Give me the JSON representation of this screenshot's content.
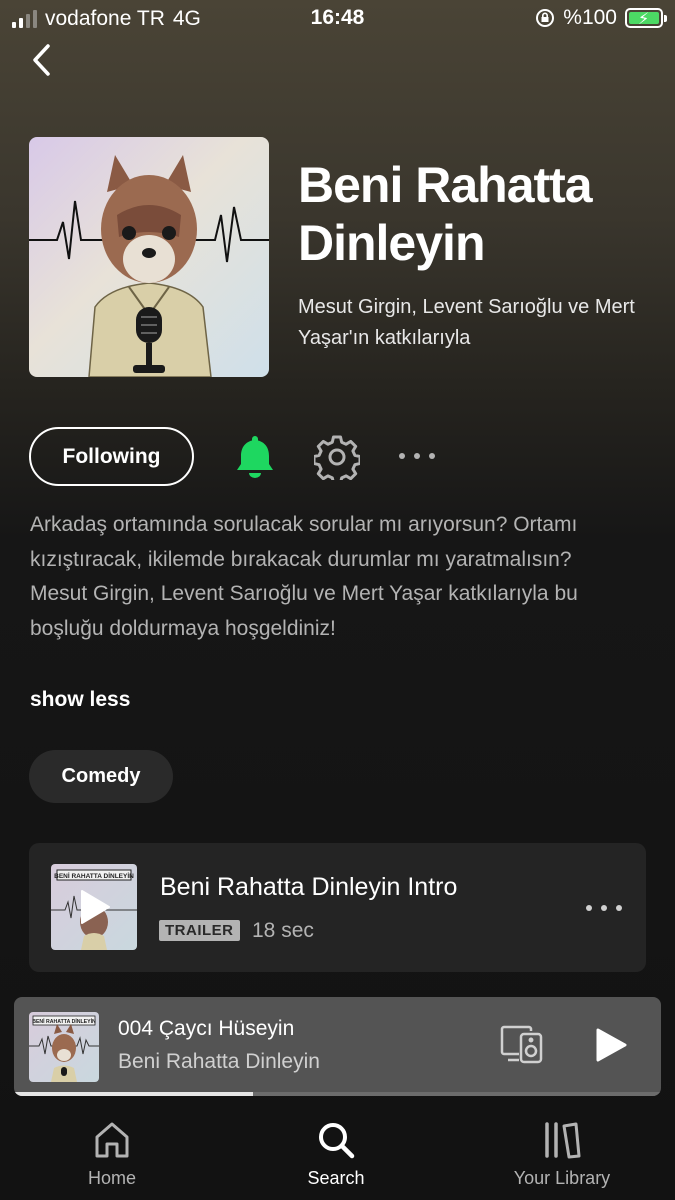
{
  "status_bar": {
    "carrier": "vodafone TR",
    "network": "4G",
    "time": "16:48",
    "battery": "%100"
  },
  "podcast": {
    "title": "Beni Rahatta Dinleyin",
    "authors": "Mesut Girgin, Levent Sarıoğlu ve Mert Yaşar'ın katkılarıyla",
    "follow_label": "Following",
    "description": [
      "Arkadaş ortamında sorulacak sorular mı arıyorsun? Ortamı kızıştıracak, ikilemde bırakacak durumlar mı yaratmalısın?",
      "Mesut Girgin, Levent Sarıoğlu ve Mert Yaşar katkılarıyla bu boşluğu doldurmaya hoşgeldiniz!"
    ],
    "show_less_label": "show less",
    "genre": "Comedy"
  },
  "episode": {
    "title": "Beni Rahatta Dinleyin Intro",
    "badge": "TRAILER",
    "duration": "18 sec",
    "thumb_banner": "BENİ RAHATTA DİNLEYİN"
  },
  "now_playing": {
    "title": "004 Çaycı Hüseyin",
    "show": "Beni Rahatta Dinleyin",
    "thumb_banner": "BENİ RAHATTA DİNLEYİN",
    "progress_fraction": 0.37
  },
  "nav": {
    "home": "Home",
    "search": "Search",
    "library": "Your Library"
  },
  "colors": {
    "accent_green": "#1ed760",
    "background": "#121212"
  }
}
